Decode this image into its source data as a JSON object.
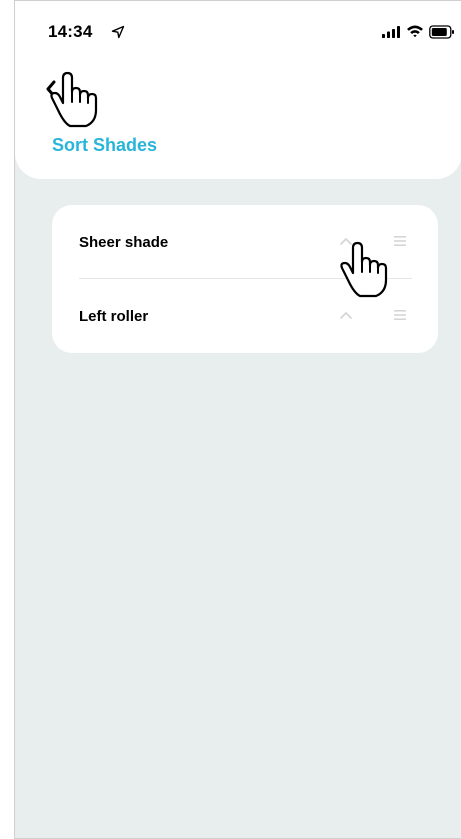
{
  "status_bar": {
    "time": "14:34",
    "icons": [
      "location-arrow-icon",
      "signal-icon",
      "wifi-icon",
      "battery-icon"
    ]
  },
  "header": {
    "back_icon": "chevron-left-icon",
    "title": "Sort Shades"
  },
  "shades": [
    {
      "label": "Sheer shade",
      "up_icon": "chevron-up-icon",
      "handle_icon": "drag-handle-icon"
    },
    {
      "label": "Left roller",
      "up_icon": "chevron-up-icon",
      "handle_icon": "drag-handle-icon"
    }
  ],
  "colors": {
    "accent": "#29b5d9",
    "background": "#e8eeee",
    "card": "#ffffff",
    "control_muted": "#d6d6d6"
  }
}
